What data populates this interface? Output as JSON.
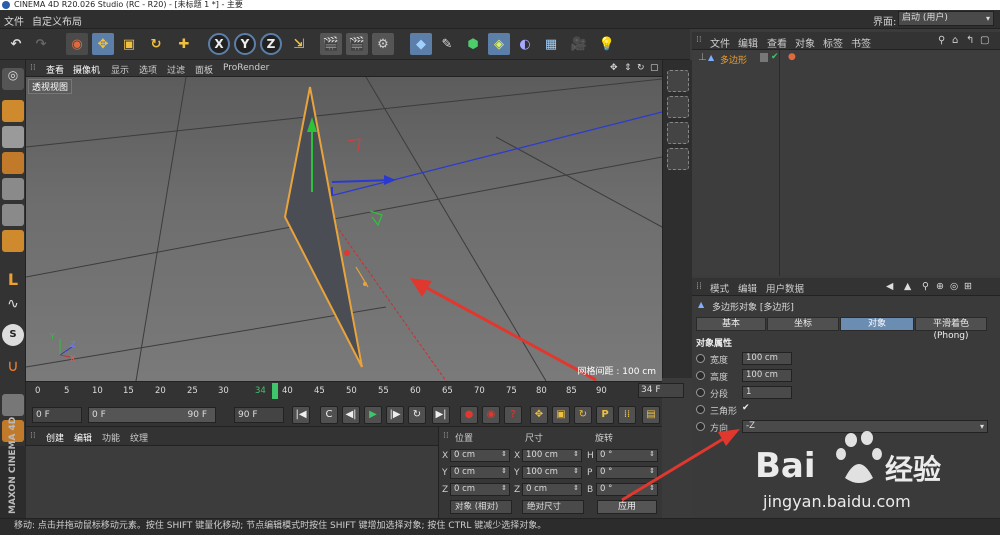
{
  "window": {
    "title": "CINEMA 4D R20.026 Studio (RC - R20) - [未标题 1 *] - 主要"
  },
  "menubar": {
    "items": [
      "文件",
      "自定义布局"
    ],
    "layout_label": "界面:",
    "layout_value": "启动 (用户)"
  },
  "viewport": {
    "menu": [
      "查看",
      "摄像机",
      "显示",
      "选项",
      "过滤",
      "面板",
      "ProRender"
    ],
    "label": "透视视图",
    "grid_spacing": "网格间距 : 100 cm",
    "axis": {
      "x": "X",
      "y": "Y",
      "z": "Z"
    }
  },
  "timeline": {
    "ticks": [
      "0",
      "5",
      "10",
      "15",
      "20",
      "25",
      "30",
      "34",
      "40",
      "45",
      "50",
      "55",
      "60",
      "65",
      "70",
      "75",
      "80",
      "85",
      "90"
    ],
    "current_frame": "34",
    "frame_field": "34 F"
  },
  "transport": {
    "start": "0 F",
    "range_start": "0 F",
    "range_end": "90 F",
    "end": "90 F",
    "buttons": [
      "|◀",
      "C",
      "◀|",
      "▶",
      "|▶",
      "↻",
      "▶|"
    ]
  },
  "material_manager": {
    "menu": [
      "创建",
      "编辑",
      "功能",
      "纹理"
    ]
  },
  "coordinates": {
    "headers": [
      "位置",
      "尺寸",
      "旋转"
    ],
    "rows": [
      {
        "axis": "X",
        "pos": "0 cm",
        "size_axis": "X",
        "size": "100 cm",
        "rot_axis": "H",
        "rot": "0 °"
      },
      {
        "axis": "Y",
        "pos": "0 cm",
        "size_axis": "Y",
        "size": "100 cm",
        "rot_axis": "P",
        "rot": "0 °"
      },
      {
        "axis": "Z",
        "pos": "0 cm",
        "size_axis": "Z",
        "size": "0 cm",
        "rot_axis": "B",
        "rot": "0 °"
      }
    ],
    "mode": "对象 (相对)",
    "size_mode": "绝对尺寸",
    "apply": "应用"
  },
  "object_manager": {
    "menu": [
      "文件",
      "编辑",
      "查看",
      "对象",
      "标签",
      "书签"
    ],
    "objects": [
      {
        "name": "多边形"
      }
    ]
  },
  "attribute_manager": {
    "menu": [
      "模式",
      "编辑",
      "用户数据"
    ],
    "title": "多边形对象 [多边形]",
    "tabs": [
      "基本",
      "坐标",
      "对象",
      "平滑着色(Phong)"
    ],
    "active_tab": "对象",
    "section": "对象属性",
    "props": [
      {
        "label": "宽度",
        "value": "100 cm"
      },
      {
        "label": "高度",
        "value": "100 cm"
      },
      {
        "label": "分段",
        "value": "1"
      },
      {
        "label": "三角形",
        "value": "✔"
      },
      {
        "label": "方向",
        "value": "-Z"
      }
    ]
  },
  "brand": {
    "maxon": "MAXON CINEMA 4D"
  },
  "statusbar": {
    "text": "移动: 点击并拖动鼠标移动元素。按住 SHIFT 键量化移动; 节点编辑模式时按住 SHIFT 键增加选择对象; 按住 CTRL 键减少选择对象。"
  },
  "watermark": {
    "brand": "Bai",
    "cn": "经验",
    "url": "jingyan.baidu.com"
  },
  "colors": {
    "accent": "#5b7fa8",
    "selection": "#e8a33c",
    "playhead": "#3fc66a",
    "arrow": "#e0382e"
  }
}
